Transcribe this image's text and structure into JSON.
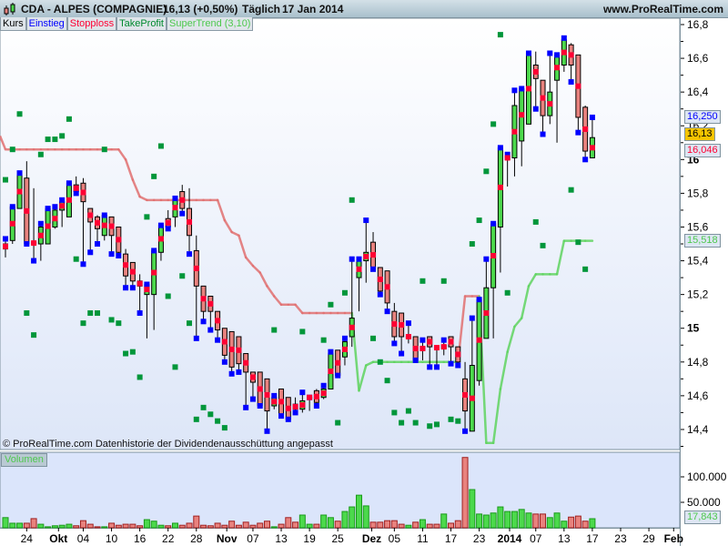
{
  "header": {
    "symbol": "CDA - ALPES (COMPAGNIE)",
    "price": "16,13 (+0,50%)",
    "period": "Täglich",
    "date": "17 Jan 2014",
    "site": "www.ProRealTime.com"
  },
  "legend": [
    {
      "label": "Kurs",
      "color": "#000000"
    },
    {
      "label": "Einstieg",
      "color": "#0000ff"
    },
    {
      "label": "Stopploss",
      "color": "#ff0033"
    },
    {
      "label": "TakeProfit",
      "color": "#008a2e"
    },
    {
      "label": "SuperTrend (3,10)",
      "color": "#4ec94e"
    }
  ],
  "footer": "© ProRealTime.com  Datenhistorie der Dividendenausschüttung angepasst",
  "volume_label": "Volumen",
  "last_values": {
    "einstieg": "16,250",
    "kurs": "16,13",
    "stoploss": "16,046",
    "supertrend": "15,518",
    "volume": "17,843"
  },
  "colors": {
    "up": "#4cd94c",
    "down": "#e8827e",
    "einstieg": "#0000ff",
    "stoploss": "#ff0033",
    "takeprofit": "#00963a",
    "st_up": "#5fd35f",
    "st_down": "#e07070",
    "bg_top": "#ffffff",
    "bg_bottom": "#dde6f8"
  },
  "chart_data": {
    "type": "candlestick",
    "ylim": [
      14.3,
      16.85
    ],
    "yticks": [
      "16,8",
      "16,6",
      "16,4",
      "16,2",
      "16",
      "15,8",
      "15,6",
      "15,4",
      "15,2",
      "15",
      "14,8",
      "14,6",
      "14,4"
    ],
    "ytick_values": [
      16.8,
      16.6,
      16.4,
      16.2,
      16,
      15.8,
      15.6,
      15.4,
      15.2,
      15,
      14.8,
      14.6,
      14.4
    ],
    "bold_ticks": [
      "16",
      "15"
    ],
    "volume_ticks": [
      {
        "label": "100.000",
        "value": 100000
      },
      {
        "label": "50.000",
        "value": 50000
      }
    ],
    "xticks": [
      {
        "label": "24",
        "i": 4
      },
      {
        "label": "Okt",
        "i": 8.5,
        "bold": true
      },
      {
        "label": "04",
        "i": 12
      },
      {
        "label": "10",
        "i": 16
      },
      {
        "label": "16",
        "i": 20
      },
      {
        "label": "22",
        "i": 24
      },
      {
        "label": "28",
        "i": 28
      },
      {
        "label": "Nov",
        "i": 32.3,
        "bold": true
      },
      {
        "label": "07",
        "i": 36
      },
      {
        "label": "13",
        "i": 40
      },
      {
        "label": "19",
        "i": 44
      },
      {
        "label": "25",
        "i": 48
      },
      {
        "label": "Dez",
        "i": 52.8,
        "bold": true
      },
      {
        "label": "05",
        "i": 56
      },
      {
        "label": "11",
        "i": 60
      },
      {
        "label": "17",
        "i": 64
      },
      {
        "label": "23",
        "i": 68
      },
      {
        "label": "2014",
        "i": 72.3,
        "bold": true
      },
      {
        "label": "07",
        "i": 76
      },
      {
        "label": "13",
        "i": 80
      },
      {
        "label": "17",
        "i": 84
      },
      {
        "label": "23",
        "i": 88
      },
      {
        "label": "29",
        "i": 92
      },
      {
        "label": "Feb",
        "i": 95.5,
        "bold": true
      }
    ],
    "ohlc": [
      [
        15.47,
        15.53,
        15.42,
        15.5
      ],
      [
        15.52,
        15.72,
        15.5,
        15.72
      ],
      [
        15.71,
        15.92,
        15.71,
        15.91
      ],
      [
        15.89,
        15.99,
        15.5,
        15.5
      ],
      [
        15.51,
        15.83,
        15.4,
        15.5
      ],
      [
        15.5,
        15.62,
        15.4,
        15.6
      ],
      [
        15.5,
        15.71,
        15.5,
        15.71
      ],
      [
        15.6,
        15.72,
        15.59,
        15.7
      ],
      [
        15.7,
        15.76,
        15.6,
        15.75
      ],
      [
        15.66,
        15.86,
        15.66,
        15.86
      ],
      [
        15.85,
        15.9,
        15.8,
        15.81
      ],
      [
        15.86,
        15.89,
        15.38,
        15.75
      ],
      [
        15.71,
        15.71,
        15.45,
        15.63
      ],
      [
        15.66,
        15.67,
        15.5,
        15.59
      ],
      [
        15.55,
        15.67,
        15.52,
        15.67
      ],
      [
        15.66,
        15.66,
        15.44,
        15.55
      ],
      [
        15.6,
        15.6,
        15.43,
        15.45
      ],
      [
        15.44,
        15.47,
        15.24,
        15.31
      ],
      [
        15.39,
        15.39,
        15.24,
        15.28
      ],
      [
        15.28,
        15.32,
        15.09,
        15.25
      ],
      [
        15.2,
        15.26,
        14.94,
        15.26
      ],
      [
        15.2,
        15.46,
        14.99,
        15.46
      ],
      [
        15.45,
        15.61,
        15.4,
        15.61
      ],
      [
        15.65,
        15.7,
        15.59,
        15.6
      ],
      [
        15.66,
        15.77,
        15.6,
        15.77
      ],
      [
        15.81,
        15.85,
        15.68,
        15.71
      ],
      [
        15.71,
        15.83,
        15.44,
        15.55
      ],
      [
        15.46,
        15.55,
        14.94,
        15.25
      ],
      [
        15.25,
        15.25,
        15.04,
        15.1
      ],
      [
        15.19,
        15.19,
        14.99,
        15.1
      ],
      [
        15.1,
        15.1,
        14.93,
        14.99
      ],
      [
        15.0,
        15.0,
        14.8,
        14.84
      ],
      [
        14.98,
        14.98,
        14.73,
        14.77
      ],
      [
        14.95,
        14.95,
        14.74,
        14.79
      ],
      [
        14.85,
        14.85,
        14.53,
        14.74
      ],
      [
        14.74,
        14.74,
        14.58,
        14.68
      ],
      [
        14.74,
        14.74,
        14.54,
        14.54
      ],
      [
        14.7,
        14.7,
        14.39,
        14.51
      ],
      [
        14.54,
        14.6,
        14.52,
        14.59
      ],
      [
        14.64,
        14.64,
        14.48,
        14.49
      ],
      [
        14.59,
        14.59,
        14.46,
        14.46
      ],
      [
        14.55,
        14.59,
        14.5,
        14.52
      ],
      [
        14.52,
        14.62,
        14.5,
        14.57
      ],
      [
        14.59,
        14.59,
        14.51,
        14.59
      ],
      [
        14.63,
        14.64,
        14.54,
        14.56
      ],
      [
        14.59,
        14.66,
        14.58,
        14.64
      ],
      [
        14.64,
        14.86,
        14.64,
        14.85
      ],
      [
        14.87,
        14.87,
        14.72,
        14.72
      ],
      [
        14.83,
        14.94,
        14.78,
        14.92
      ],
      [
        14.95,
        15.41,
        14.89,
        15.06
      ],
      [
        15.3,
        15.41,
        15.1,
        15.4
      ],
      [
        15.4,
        15.64,
        15.27,
        15.45
      ],
      [
        15.51,
        15.57,
        15.35,
        15.36
      ],
      [
        15.36,
        15.36,
        15.2,
        15.22
      ],
      [
        15.34,
        15.34,
        15.1,
        15.15
      ],
      [
        15.1,
        15.15,
        14.91,
        14.95
      ],
      [
        15.09,
        15.09,
        14.85,
        14.95
      ],
      [
        14.95,
        15.03,
        14.91,
        14.95
      ],
      [
        14.95,
        14.95,
        14.81,
        14.81
      ],
      [
        14.87,
        14.93,
        14.81,
        14.89
      ],
      [
        14.95,
        14.95,
        14.77,
        14.89
      ],
      [
        14.89,
        14.89,
        14.77,
        14.88
      ],
      [
        14.88,
        14.93,
        14.84,
        14.9
      ],
      [
        14.95,
        14.95,
        14.79,
        14.89
      ],
      [
        14.89,
        14.89,
        14.78,
        14.8
      ],
      [
        14.7,
        14.8,
        14.39,
        14.51
      ],
      [
        14.39,
        15.06,
        14.39,
        14.78
      ],
      [
        14.69,
        15.17,
        14.66,
        15.17
      ],
      [
        14.94,
        15.41,
        14.94,
        15.24
      ],
      [
        15.24,
        15.62,
        14.94,
        15.62
      ],
      [
        15.6,
        16.07,
        15.33,
        16.07
      ],
      [
        16.0,
        16.03,
        15.84,
        16.02
      ],
      [
        16.01,
        16.41,
        15.9,
        16.32
      ],
      [
        16.11,
        16.42,
        15.96,
        16.42
      ],
      [
        16.21,
        16.63,
        16.21,
        16.63
      ],
      [
        16.56,
        16.64,
        16.3,
        16.48
      ],
      [
        16.47,
        16.47,
        16.15,
        16.26
      ],
      [
        16.26,
        16.63,
        16.21,
        16.4
      ],
      [
        16.47,
        16.62,
        16.1,
        16.62
      ],
      [
        16.56,
        16.72,
        16.52,
        16.71
      ],
      [
        16.68,
        16.69,
        16.46,
        16.56
      ],
      [
        16.62,
        16.62,
        16.16,
        16.25
      ],
      [
        16.31,
        16.32,
        16.0,
        16.05
      ],
      [
        16.01,
        16.25,
        16.01,
        16.13
      ]
    ],
    "volume": [
      20000,
      9000,
      9000,
      9000,
      18000,
      7000,
      2000,
      4000,
      5000,
      7000,
      4000,
      14000,
      7000,
      2000,
      2000,
      9000,
      5000,
      7000,
      7000,
      4000,
      16000,
      13000,
      5000,
      4000,
      9000,
      5000,
      9000,
      23000,
      5000,
      4000,
      9000,
      5000,
      13000,
      5000,
      11000,
      5000,
      9000,
      13000,
      2000,
      7000,
      20000,
      11000,
      25000,
      7000,
      7000,
      25000,
      20000,
      13000,
      32000,
      41000,
      64000,
      43000,
      11000,
      11000,
      14000,
      14000,
      7000,
      5000,
      11000,
      16000,
      7000,
      7000,
      27000,
      9000,
      14000,
      138000,
      75000,
      27000,
      25000,
      29000,
      41000,
      32000,
      32000,
      36000,
      29000,
      27000,
      27000,
      20000,
      29000,
      13000,
      21000,
      23000,
      13000,
      17843
    ],
    "supertrend": [
      16.06,
      16.06,
      16.06,
      16.06,
      16.06,
      16.06,
      16.06,
      16.06,
      16.06,
      16.06,
      16.06,
      16.06,
      16.06,
      16.06,
      16.06,
      16.06,
      16.06,
      16.0,
      15.88,
      15.78,
      15.76,
      15.76,
      15.76,
      15.76,
      15.76,
      15.76,
      15.76,
      15.76,
      15.76,
      15.76,
      15.76,
      15.64,
      15.57,
      15.55,
      15.42,
      15.37,
      15.33,
      15.25,
      15.19,
      15.14,
      15.14,
      15.14,
      15.09,
      15.09,
      15.09,
      15.09,
      15.09,
      15.09,
      15.09,
      15.09,
      14.63,
      14.78,
      14.8,
      14.8,
      14.8,
      14.8,
      14.8,
      14.8,
      14.8,
      14.8,
      14.8,
      14.8,
      14.8,
      14.8,
      14.8,
      15.19,
      15.19,
      15.19,
      14.32,
      14.32,
      14.64,
      14.86,
      15.01,
      15.06,
      15.25,
      15.32,
      15.32,
      15.32,
      15.32,
      15.518,
      15.518,
      15.518,
      15.518,
      15.518
    ],
    "supertrend_direction": "down 1-50, up 50-65, down 65-68, up 68-84",
    "takeprofit": [
      [
        1,
        15.88
      ],
      [
        2,
        16.06
      ],
      [
        3,
        16.27
      ],
      [
        4,
        15.09
      ],
      [
        5,
        14.96
      ],
      [
        6,
        16.03
      ],
      [
        7,
        16.12
      ],
      [
        8,
        16.12
      ],
      [
        9,
        16.14
      ],
      [
        10,
        16.24
      ],
      [
        11,
        15.41
      ],
      [
        12,
        15.03
      ],
      [
        13,
        15.09
      ],
      [
        14,
        15.09
      ],
      [
        15,
        16.06
      ],
      [
        16,
        15.05
      ],
      [
        17,
        15.03
      ],
      [
        18,
        14.85
      ],
      [
        19,
        14.86
      ],
      [
        20,
        14.71
      ],
      [
        21,
        15.66
      ],
      [
        22,
        15.9
      ],
      [
        23,
        16.08
      ],
      [
        24,
        15.19
      ],
      [
        25,
        14.77
      ],
      [
        26,
        15.31
      ],
      [
        27,
        15.03
      ],
      [
        28,
        14.46
      ],
      [
        29,
        14.53
      ],
      [
        30,
        14.49
      ],
      [
        31,
        14.45
      ],
      [
        32,
        14.41
      ],
      [
        39,
        14.99
      ],
      [
        43,
        14.98
      ],
      [
        46,
        14.93
      ],
      [
        47,
        15.14
      ],
      [
        48,
        14.44
      ],
      [
        49,
        15.21
      ],
      [
        50,
        15.76
      ],
      [
        53,
        14.94
      ],
      [
        54,
        14.8
      ],
      [
        55,
        14.69
      ],
      [
        56,
        14.5
      ],
      [
        57,
        14.44
      ],
      [
        58,
        14.51
      ],
      [
        59,
        14.44
      ],
      [
        60,
        15.28
      ],
      [
        61,
        14.42
      ],
      [
        62,
        14.43
      ],
      [
        63,
        15.28
      ],
      [
        64,
        14.46
      ],
      [
        65,
        14.45
      ],
      [
        67,
        15.5
      ],
      [
        68,
        15.64
      ],
      [
        69,
        15.93
      ],
      [
        70,
        16.21
      ],
      [
        71,
        16.74
      ],
      [
        72,
        15.21
      ],
      [
        76,
        15.63
      ],
      [
        77,
        15.49
      ],
      [
        81,
        15.82
      ],
      [
        82,
        15.51
      ],
      [
        83,
        15.35
      ]
    ]
  }
}
